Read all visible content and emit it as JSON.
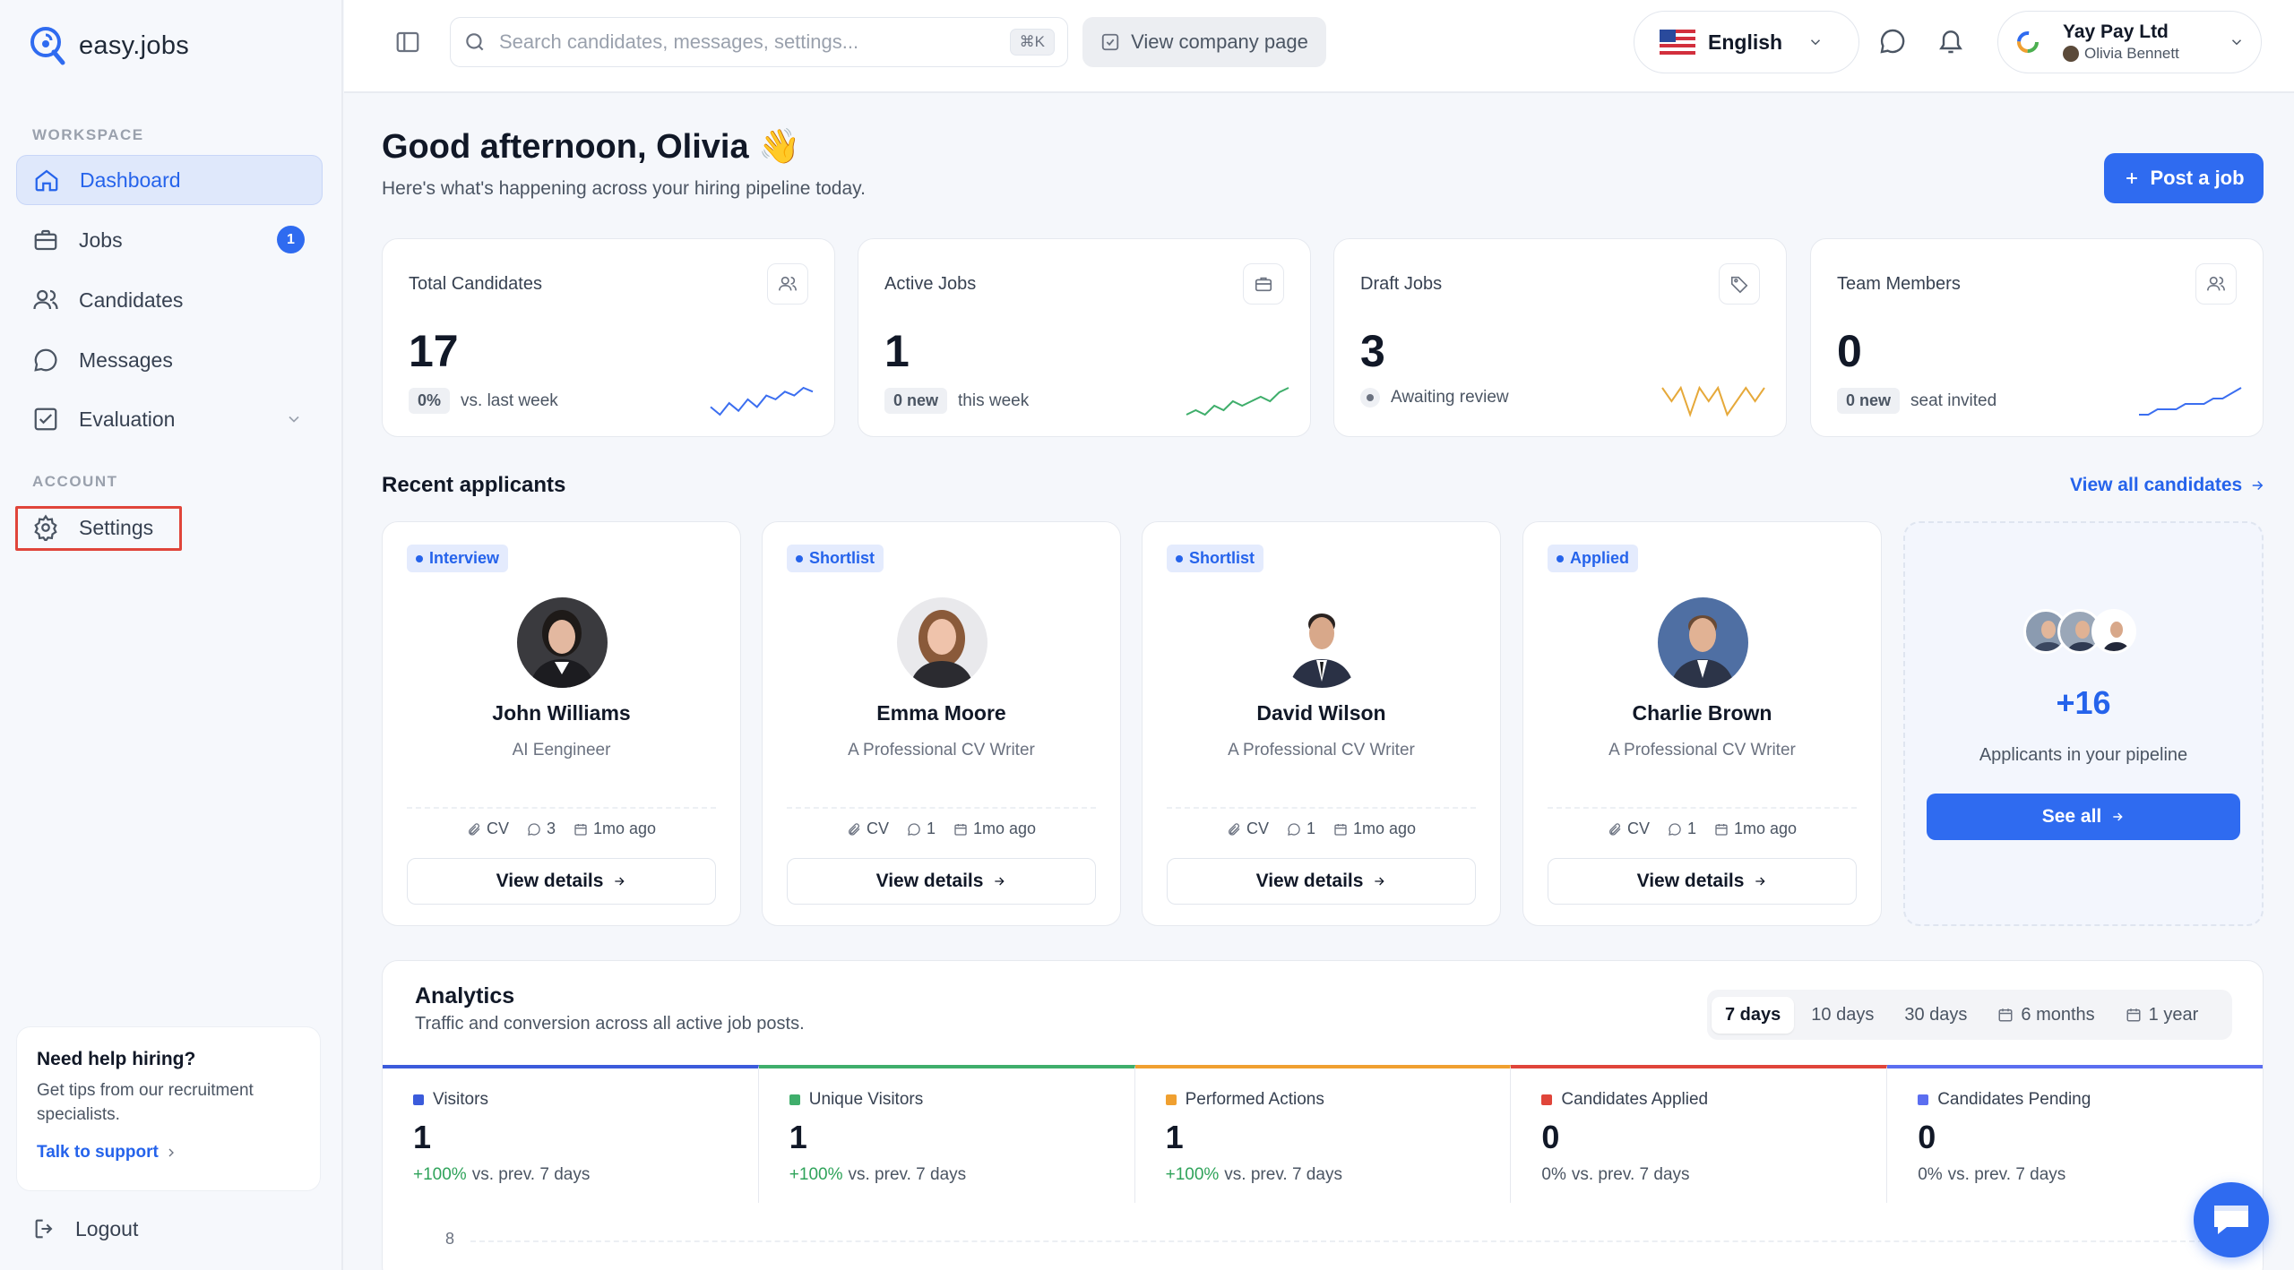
{
  "brand": {
    "name": "easy.jobs"
  },
  "sidebar": {
    "workspace_title": "WORKSPACE",
    "account_title": "ACCOUNT",
    "items": [
      {
        "label": "Dashboard",
        "icon": "home-icon"
      },
      {
        "label": "Jobs",
        "icon": "briefcase-icon",
        "badge": "1"
      },
      {
        "label": "Candidates",
        "icon": "users-icon"
      },
      {
        "label": "Messages",
        "icon": "message-icon"
      },
      {
        "label": "Evaluation",
        "icon": "checklist-icon"
      }
    ],
    "settings_label": "Settings",
    "help": {
      "title": "Need help hiring?",
      "body": "Get tips from our recruitment specialists.",
      "link": "Talk to support"
    },
    "logout_label": "Logout"
  },
  "topbar": {
    "search_placeholder": "Search candidates, messages, settings...",
    "shortcut": "⌘K",
    "company_page_label": "View company page",
    "language": "English",
    "profile": {
      "company": "Yay Pay Ltd",
      "user": "Olivia Bennett"
    }
  },
  "greeting": {
    "title": "Good afternoon, Olivia 👋",
    "subtitle": "Here's what's happening across your hiring pipeline today.",
    "post_job_label": "Post a job"
  },
  "stats": [
    {
      "label": "Total Candidates",
      "value": "17",
      "pill": "0%",
      "note": "vs. last week",
      "spark_color": "#3b6ef0",
      "spark": [
        4,
        2,
        5,
        3,
        6,
        4,
        7,
        6,
        8,
        7,
        9,
        8
      ]
    },
    {
      "label": "Active Jobs",
      "value": "1",
      "pill": "0 new",
      "note": "this week",
      "spark_color": "#3fae6b",
      "spark": [
        2,
        3,
        2,
        4,
        3,
        5,
        4,
        5,
        6,
        5,
        7,
        8
      ]
    },
    {
      "label": "Draft Jobs",
      "value": "3",
      "pill": "",
      "note": "Awaiting review",
      "spark_color": "#e6a93a",
      "spark": [
        5,
        4,
        5,
        3,
        5,
        4,
        5,
        3,
        4,
        5,
        4,
        5
      ]
    },
    {
      "label": "Team Members",
      "value": "0",
      "pill": "0 new",
      "note": "seat invited",
      "spark_color": "#3b6ef0",
      "spark": [
        2,
        2,
        3,
        3,
        3,
        4,
        4,
        4,
        5,
        5,
        6,
        7
      ]
    }
  ],
  "recent": {
    "title": "Recent applicants",
    "view_all": "View all candidates",
    "applicants": [
      {
        "status": "Interview",
        "name": "John Williams",
        "role": "AI Eengineer",
        "cv": "CV",
        "comments": "3",
        "time": "1mo ago",
        "btn": "View details"
      },
      {
        "status": "Shortlist",
        "name": "Emma Moore",
        "role": "A Professional CV Writer",
        "cv": "CV",
        "comments": "1",
        "time": "1mo ago",
        "btn": "View details"
      },
      {
        "status": "Shortlist",
        "name": "David Wilson",
        "role": "A Professional CV Writer",
        "cv": "CV",
        "comments": "1",
        "time": "1mo ago",
        "btn": "View details"
      },
      {
        "status": "Applied",
        "name": "Charlie Brown",
        "role": "A Professional CV Writer",
        "cv": "CV",
        "comments": "1",
        "time": "1mo ago",
        "btn": "View details"
      }
    ],
    "more": {
      "count": "+16",
      "label": "Applicants in your pipeline",
      "btn": "See all"
    }
  },
  "analytics": {
    "title": "Analytics",
    "subtitle": "Traffic and conversion across all active job posts.",
    "ranges": [
      "7 days",
      "10 days",
      "30 days",
      "6 months",
      "1 year"
    ],
    "selected_range": "7 days",
    "metrics": [
      {
        "label": "Visitors",
        "value": "1",
        "change": "+100%",
        "note": "vs. prev. 7 days",
        "color": "#3b5bdb"
      },
      {
        "label": "Unique Visitors",
        "value": "1",
        "change": "+100%",
        "note": "vs. prev. 7 days",
        "color": "#3fae6b"
      },
      {
        "label": "Performed Actions",
        "value": "1",
        "change": "+100%",
        "note": "vs. prev. 7 days",
        "color": "#f0a030"
      },
      {
        "label": "Candidates Applied",
        "value": "0",
        "change": "0%",
        "note": "vs. prev. 7 days",
        "color": "#e0453a"
      },
      {
        "label": "Candidates Pending",
        "value": "0",
        "change": "0%",
        "note": "vs. prev. 7 days",
        "color": "#5b6ef0"
      }
    ],
    "y_tick": "8"
  }
}
